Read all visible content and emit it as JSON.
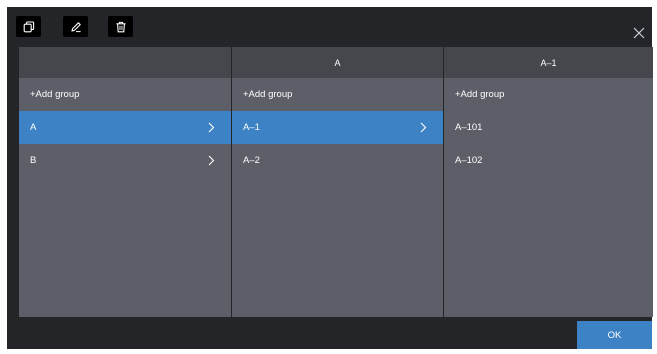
{
  "toolbar": {
    "icons": [
      "copy-icon",
      "edit-icon",
      "trash-icon"
    ]
  },
  "colors": {
    "dialog_bg": "#232529",
    "column_bg": "#5c5f67",
    "header_bg": "#45474d",
    "selected_bg": "#3d82c4"
  },
  "columns": [
    {
      "header": "",
      "rows": [
        {
          "label": "+Add group",
          "chevron": false,
          "selected": false
        },
        {
          "label": "A",
          "chevron": true,
          "selected": true
        },
        {
          "label": "B",
          "chevron": true,
          "selected": false
        }
      ]
    },
    {
      "header": "A",
      "rows": [
        {
          "label": "+Add group",
          "chevron": false,
          "selected": false
        },
        {
          "label": "A–1",
          "chevron": true,
          "selected": true
        },
        {
          "label": "A–2",
          "chevron": false,
          "selected": false
        }
      ]
    },
    {
      "header": "A–1",
      "rows": [
        {
          "label": "+Add group",
          "chevron": false,
          "selected": false
        },
        {
          "label": "A–101",
          "chevron": false,
          "selected": false
        },
        {
          "label": "A–102",
          "chevron": false,
          "selected": false
        }
      ]
    }
  ],
  "footer": {
    "ok_label": "OK"
  }
}
